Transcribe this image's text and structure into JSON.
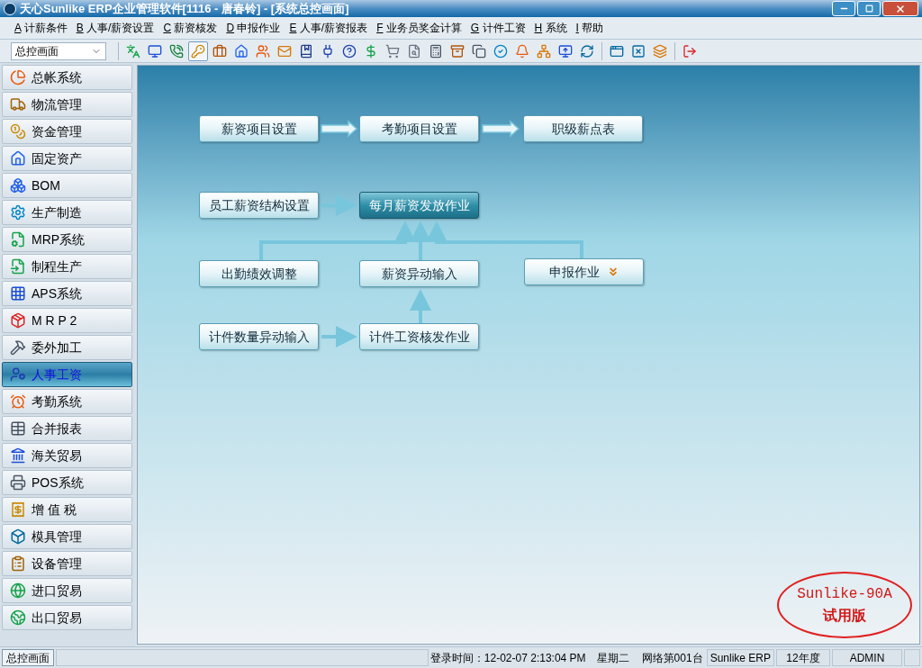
{
  "window": {
    "title": "天心Sunlike ERP企业管理软件[1116 - 唐春铃] - [系统总控画面]"
  },
  "menu": [
    {
      "key": "A",
      "label": "计薪条件"
    },
    {
      "key": "B",
      "label": "人事/薪资设置"
    },
    {
      "key": "C",
      "label": "薪资核发"
    },
    {
      "key": "D",
      "label": "申报作业"
    },
    {
      "key": "E",
      "label": "人事/薪资报表"
    },
    {
      "key": "F",
      "label": "业务员奖金计算"
    },
    {
      "key": "G",
      "label": "计件工资"
    },
    {
      "key": "H",
      "label": "系统"
    },
    {
      "key": "I",
      "label": "帮助"
    }
  ],
  "toolbar": {
    "view_select": "总控画面",
    "groups": [
      [
        {
          "selected": false
        },
        {
          "selected": false
        },
        {
          "selected": false
        },
        {
          "selected": true
        },
        {
          "selected": false
        },
        {
          "selected": false
        },
        {
          "selected": false
        },
        {
          "selected": false
        },
        {
          "selected": false
        },
        {
          "selected": false
        },
        {
          "selected": false
        },
        {
          "selected": false
        },
        {
          "selected": false
        },
        {
          "selected": false
        },
        {
          "selected": false
        },
        {
          "selected": false
        },
        {
          "selected": false
        },
        {
          "selected": false
        },
        {
          "selected": false
        },
        {
          "selected": false
        },
        {
          "selected": false
        },
        {
          "selected": false
        }
      ],
      [
        {
          "selected": false
        },
        {
          "selected": false
        },
        {
          "selected": false
        }
      ],
      [
        {
          "selected": false
        }
      ]
    ]
  },
  "sidebar": {
    "items": [
      {
        "label": "总帐系统",
        "selected": false
      },
      {
        "label": "物流管理",
        "selected": false
      },
      {
        "label": "资金管理",
        "selected": false
      },
      {
        "label": "固定资产",
        "selected": false
      },
      {
        "label": "BOM",
        "selected": false
      },
      {
        "label": "生产制造",
        "selected": false
      },
      {
        "label": "MRP系统",
        "selected": false
      },
      {
        "label": "制程生产",
        "selected": false
      },
      {
        "label": "APS系统",
        "selected": false
      },
      {
        "label": "M R P 2",
        "selected": false
      },
      {
        "label": "委外加工",
        "selected": false
      },
      {
        "label": "人事工资",
        "selected": true
      },
      {
        "label": "考勤系统",
        "selected": false
      },
      {
        "label": "合并报表",
        "selected": false
      },
      {
        "label": "海关贸易",
        "selected": false
      },
      {
        "label": "POS系统",
        "selected": false
      },
      {
        "label": "增 值 税",
        "selected": false
      },
      {
        "label": "模具管理",
        "selected": false
      },
      {
        "label": "设备管理",
        "selected": false
      },
      {
        "label": "进口贸易",
        "selected": false
      },
      {
        "label": "出口贸易",
        "selected": false
      }
    ]
  },
  "flow": {
    "nodes": [
      {
        "label": "薪资项目设置",
        "kind": "plain",
        "selected": false
      },
      {
        "label": "考勤项目设置",
        "kind": "plain",
        "selected": false
      },
      {
        "label": "职级薪点表",
        "kind": "plain",
        "selected": false
      },
      {
        "label": "员工薪资结构设置",
        "kind": "plain",
        "selected": false
      },
      {
        "label": "每月薪资发放作业",
        "kind": "plain",
        "selected": true
      },
      {
        "label": "出勤绩效调整",
        "kind": "plain",
        "selected": false
      },
      {
        "label": "薪资异动输入",
        "kind": "plain",
        "selected": false
      },
      {
        "label": "申报作业",
        "kind": "expandable",
        "selected": false
      },
      {
        "label": "计件数量异动输入",
        "kind": "plain",
        "selected": false
      },
      {
        "label": "计件工资核发作业",
        "kind": "plain",
        "selected": false
      }
    ]
  },
  "trial_stamp": {
    "line_1": "Sunlike-90A",
    "line_2": "试用版"
  },
  "status_bar": {
    "tab": {
      "label": "总控画面",
      "selected": true
    },
    "login_time": "登录时间：12-02-07 2:13:04 PM",
    "weekday": "星期二",
    "workstation": "网络第001台",
    "product": "Sunlike ERP",
    "fiscal_year": "12年度",
    "user": "ADMIN"
  }
}
